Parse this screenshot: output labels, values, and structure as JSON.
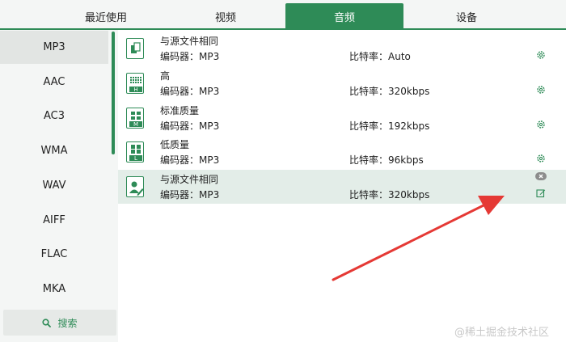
{
  "tabs": [
    {
      "label": "最近使用"
    },
    {
      "label": "视频"
    },
    {
      "label": "音频"
    },
    {
      "label": "设备"
    }
  ],
  "active_tab": "音频",
  "sidebar": {
    "items": [
      {
        "label": "MP3"
      },
      {
        "label": "AAC"
      },
      {
        "label": "AC3"
      },
      {
        "label": "WMA"
      },
      {
        "label": "WAV"
      },
      {
        "label": "AIFF"
      },
      {
        "label": "FLAC"
      },
      {
        "label": "MKA"
      }
    ],
    "selected": "MP3",
    "search_label": "搜索",
    "search_icon": "search-icon"
  },
  "presets": [
    {
      "title": "与源文件相同",
      "codec": "编码器：MP3",
      "bitrate": "比特率：Auto",
      "icon": "same-as-source-icon",
      "badge": ""
    },
    {
      "title": "高",
      "codec": "编码器：MP3",
      "bitrate": "比特率：320kbps",
      "icon": "quality-high-icon",
      "badge": "H"
    },
    {
      "title": "标准质量",
      "codec": "编码器：MP3",
      "bitrate": "比特率：192kbps",
      "icon": "quality-standard-icon",
      "badge": "M"
    },
    {
      "title": "低质量",
      "codec": "编码器：MP3",
      "bitrate": "比特率：96kbps",
      "icon": "quality-low-icon",
      "badge": "L"
    },
    {
      "title": "与源文件相同",
      "codec": "编码器：MP3",
      "bitrate": "比特率：320kbps",
      "icon": "custom-profile-icon",
      "badge": ""
    }
  ],
  "watermark": "@稀土掘金技术社区",
  "colors": {
    "accent": "#2e8b57",
    "selected_row": "#e3ede8",
    "sidebar_bg": "#f4f6f5",
    "annotation_arrow": "#e53935"
  }
}
